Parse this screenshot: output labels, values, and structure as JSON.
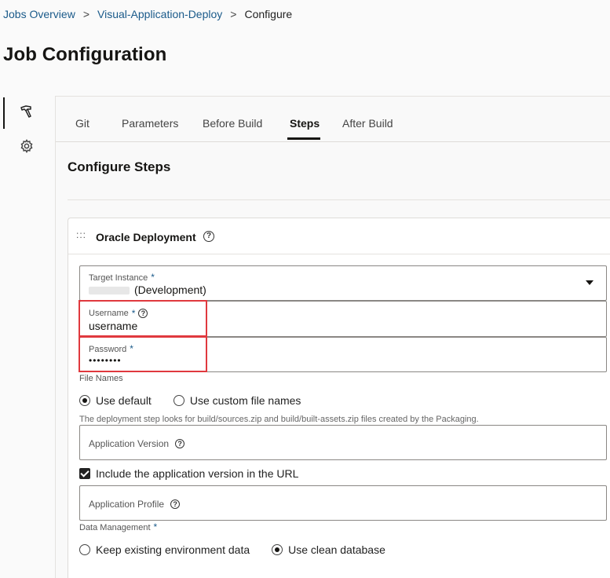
{
  "breadcrumb": {
    "items": [
      "Jobs Overview",
      "Visual-Application-Deploy"
    ],
    "current": "Configure",
    "separator": ">"
  },
  "page": {
    "title": "Job Configuration"
  },
  "rail": {
    "icons": [
      "hammer-icon",
      "gear-icon"
    ]
  },
  "tabs": [
    {
      "label": "Git"
    },
    {
      "label": "Parameters"
    },
    {
      "label": "Before Build"
    },
    {
      "label": "Steps",
      "active": true
    },
    {
      "label": "After Build"
    }
  ],
  "section": {
    "title": "Configure Steps"
  },
  "step": {
    "title": "Oracle Deployment",
    "drag": ":::",
    "help": "?",
    "target_instance": {
      "label": "Target Instance",
      "required": "*",
      "value": "(Development)"
    },
    "username": {
      "label": "Username",
      "required": "*",
      "value": "username"
    },
    "password": {
      "label": "Password",
      "required": "*",
      "value": "••••••••"
    },
    "file_names": {
      "label": "File Names",
      "options": [
        "Use default",
        "Use custom file names"
      ],
      "selected": "Use default",
      "hint": "The deployment step looks for build/sources.zip and build/built-assets.zip files created by the Packaging."
    },
    "application_version": {
      "label": "Application Version"
    },
    "include_version": {
      "label": "Include the application version in the URL",
      "checked": true
    },
    "application_profile": {
      "label": "Application Profile"
    },
    "data_management": {
      "label": "Data Management",
      "required": "*",
      "options": [
        "Keep existing environment data",
        "Use clean database"
      ],
      "selected": "Use clean database"
    }
  },
  "colors": {
    "link": "#1a5a8a",
    "highlight": "#e0393e",
    "text": "#161513"
  }
}
